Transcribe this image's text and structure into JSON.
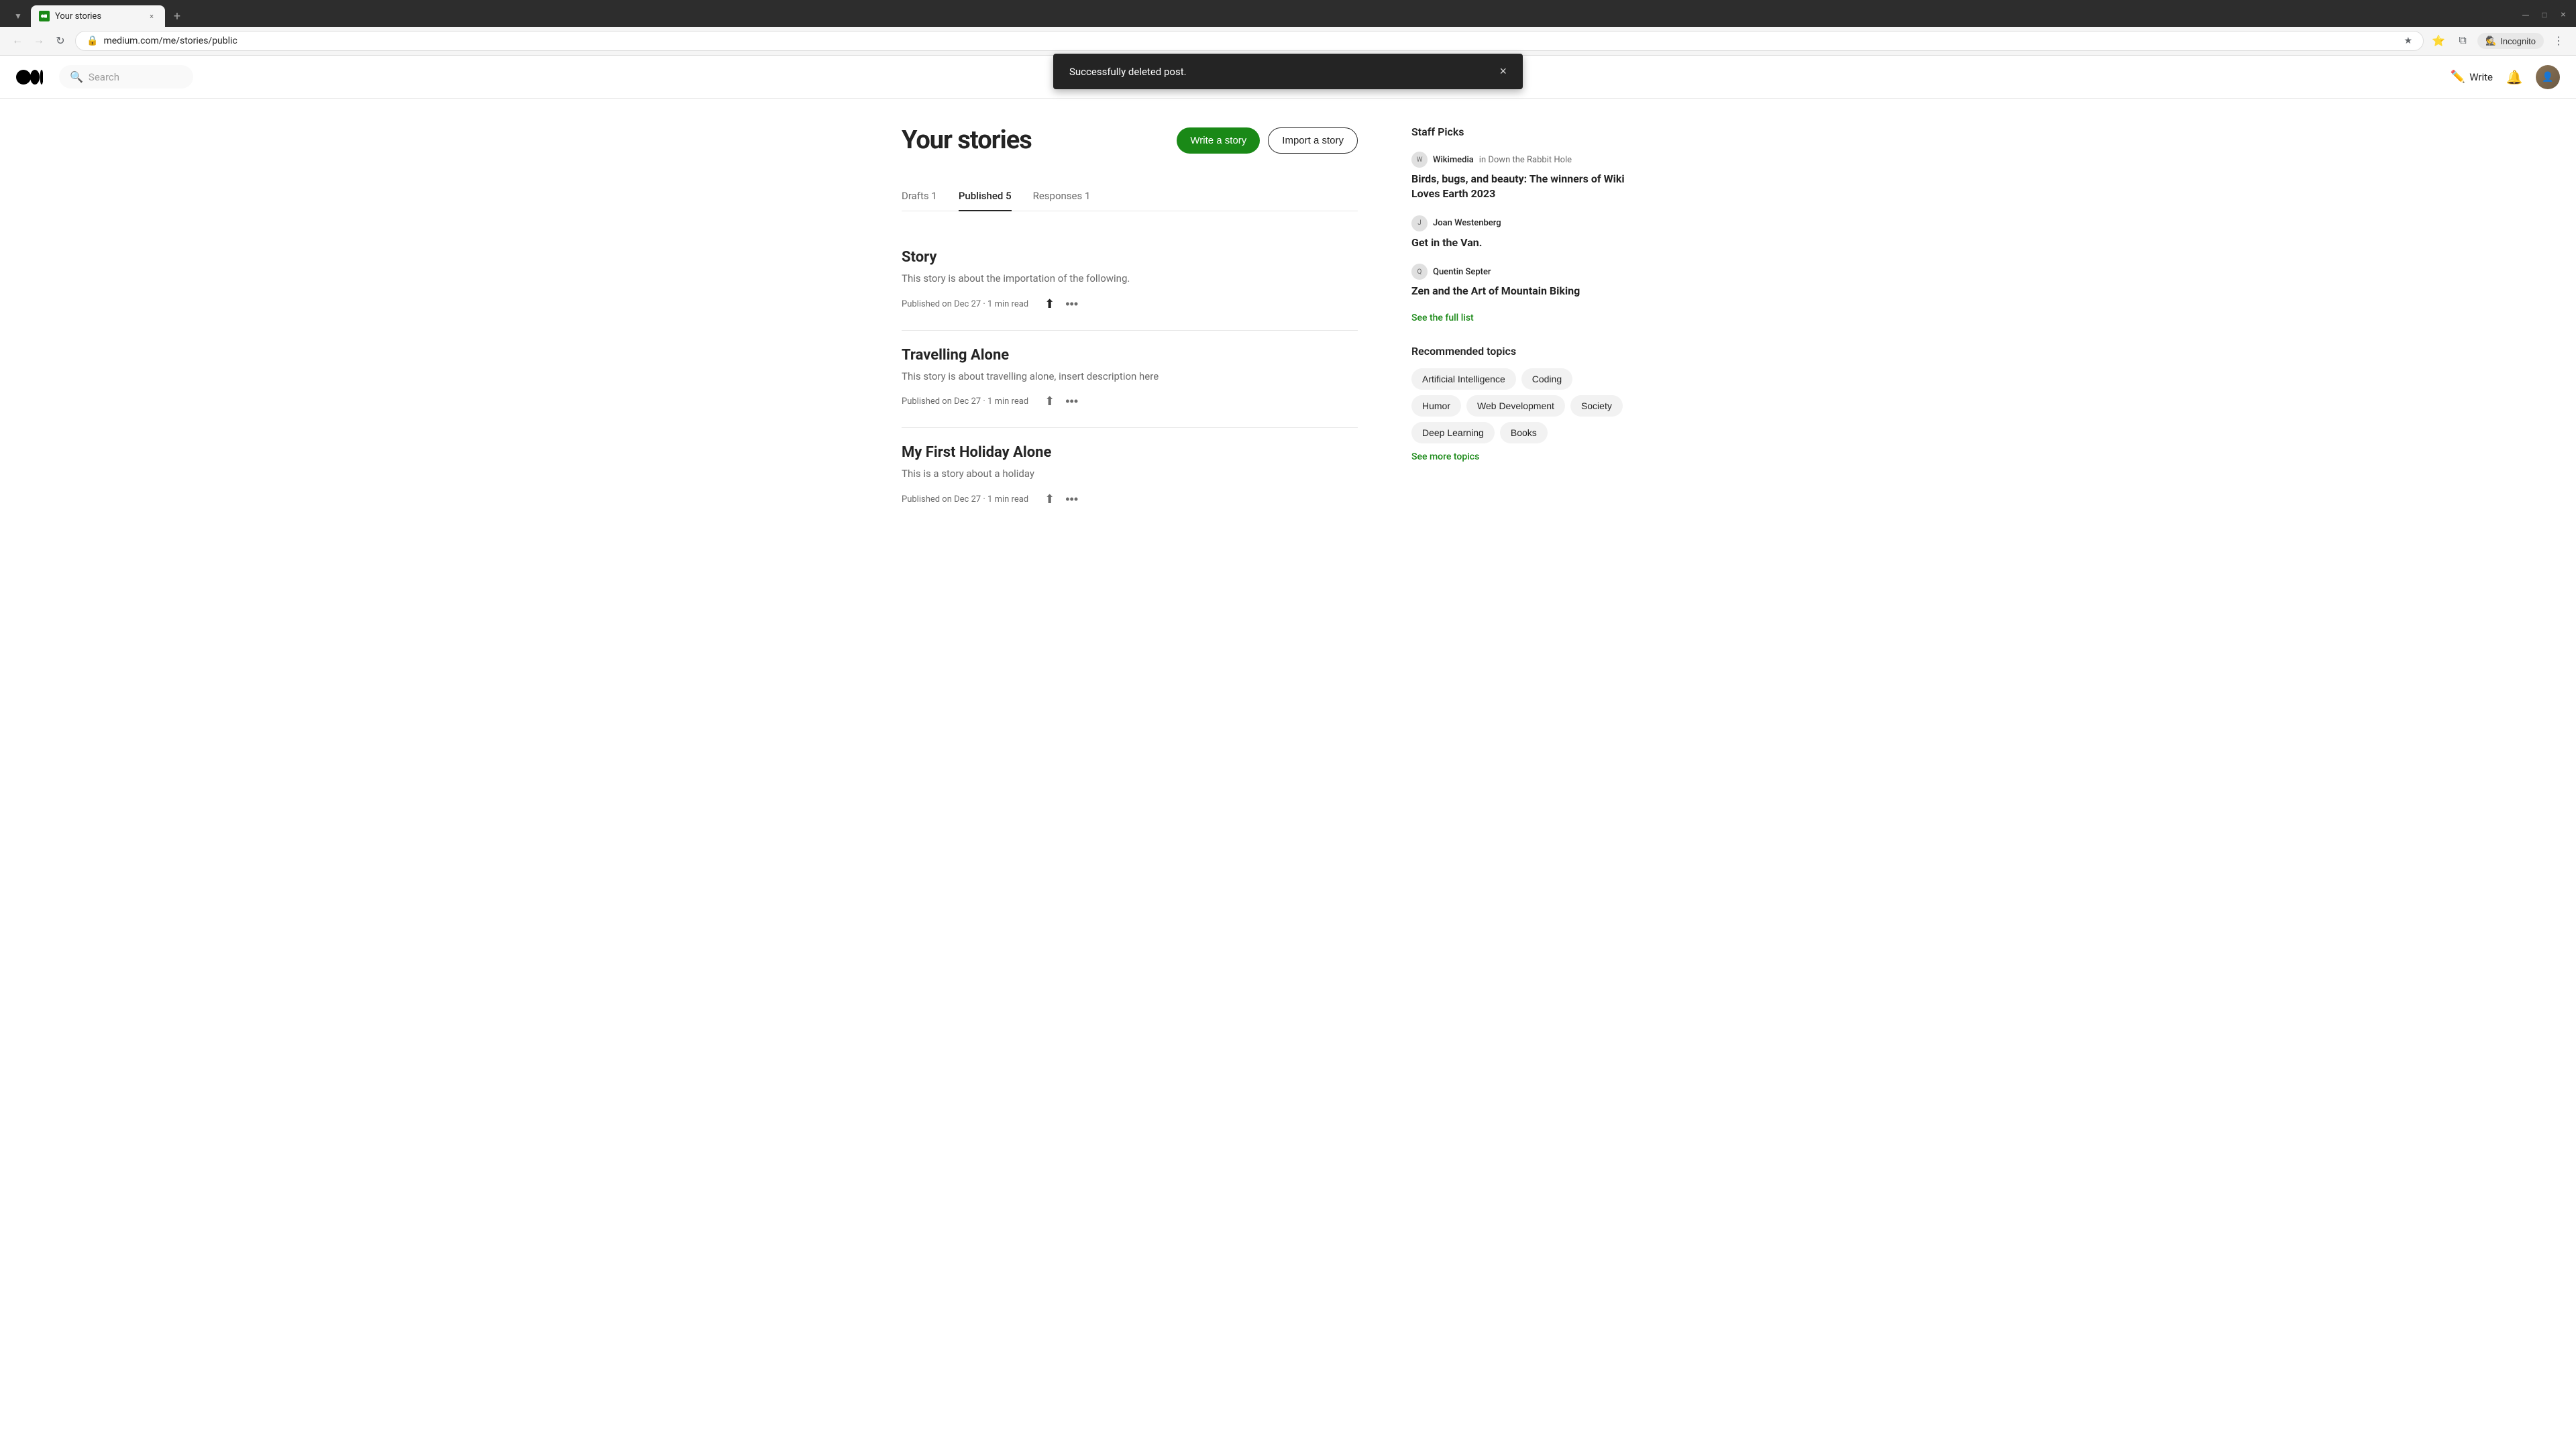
{
  "browser": {
    "tab": {
      "title": "Your stories",
      "favicon": "M"
    },
    "url": "medium.com/me/stories/public",
    "incognito_label": "Incognito",
    "nav": {
      "back": "←",
      "forward": "→",
      "refresh": "↻"
    }
  },
  "header": {
    "search_placeholder": "Search",
    "write_label": "Write",
    "logo_alt": "Medium"
  },
  "toast": {
    "message": "Successfully deleted post.",
    "close_aria": "×"
  },
  "page": {
    "title": "Your stories",
    "write_story_btn": "Write a story",
    "import_story_btn": "Import a story"
  },
  "tabs": [
    {
      "label": "Drafts 1",
      "active": false
    },
    {
      "label": "Published 5",
      "active": true
    },
    {
      "label": "Responses 1",
      "active": false
    }
  ],
  "stories": [
    {
      "title": "Story",
      "excerpt": "This story is about the importation of the following.",
      "meta": "Published on Dec 27 · 1 min read"
    },
    {
      "title": "Travelling Alone",
      "excerpt": "This story is about travelling alone, insert description here",
      "meta": "Published on Dec 27 · 1 min read"
    },
    {
      "title": "My First Holiday Alone",
      "excerpt": "This is a story about a holiday",
      "meta": "Published on Dec 27 · 1 min read"
    }
  ],
  "sidebar": {
    "staff_picks": {
      "title": "Staff Picks",
      "items": [
        {
          "author": "Wikimedia",
          "publication": "in Down the Rabbit Hole",
          "story_title": "Birds, bugs, and beauty: The winners of Wiki Loves Earth 2023",
          "author_avatar_text": "W"
        },
        {
          "author": "Joan Westenberg",
          "publication": "",
          "story_title": "Get in the Van.",
          "author_avatar_text": "J"
        },
        {
          "author": "Quentin Septer",
          "publication": "",
          "story_title": "Zen and the Art of Mountain Biking",
          "author_avatar_text": "Q"
        }
      ],
      "see_full_list": "See the full list"
    },
    "recommended_topics": {
      "title": "Recommended topics",
      "topics": [
        "Artificial Intelligence",
        "Coding",
        "Humor",
        "Web Development",
        "Society",
        "Deep Learning",
        "Books"
      ],
      "see_more": "See more topics"
    }
  }
}
